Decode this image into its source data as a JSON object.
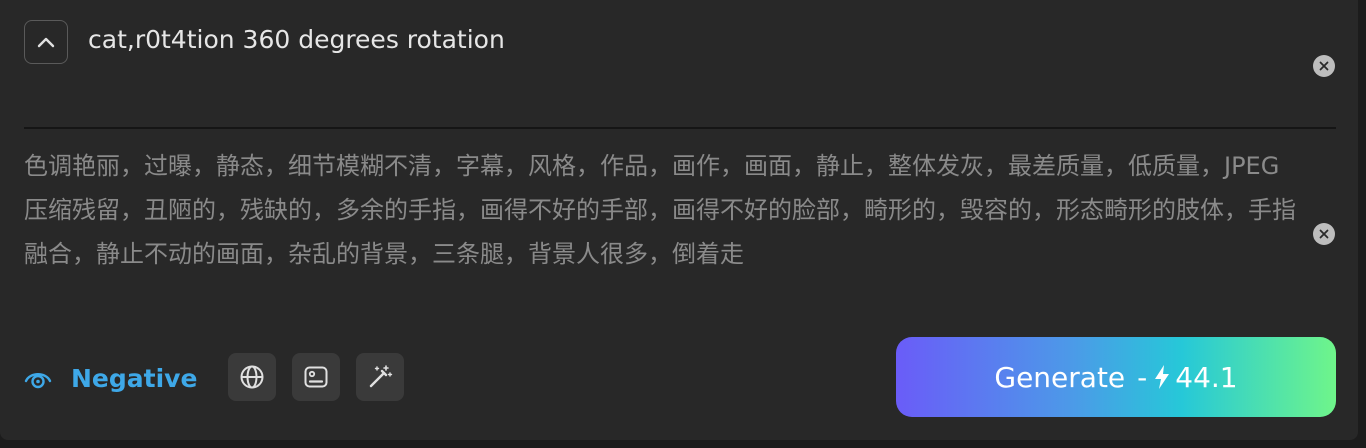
{
  "prompt": {
    "text": "cat,r0t4tion 360 degrees rotation"
  },
  "negative_prompt": {
    "text": "色调艳丽，过曝，静态，细节模糊不清，字幕，风格，作品，画作，画面，静止，整体发灰，最差质量，低质量，JPEG压缩残留，丑陋的，残缺的，多余的手指，画得不好的手部，画得不好的脸部，畸形的，毁容的，形态畸形的肢体，手指融合，静止不动的画面，杂乱的背景，三条腿，背景人很多，倒着走"
  },
  "toolbar": {
    "negative_label": "Negative",
    "icons": [
      "eye-icon",
      "globe-icon",
      "image-icon",
      "magic-wand-icon"
    ]
  },
  "generate": {
    "label": "Generate",
    "separator": "-",
    "cost": "44.1"
  },
  "colors": {
    "accent": "#3ea8e8",
    "panel": "#282828",
    "gradient_start": "#6a5cf8",
    "gradient_end": "#6ff58a"
  }
}
